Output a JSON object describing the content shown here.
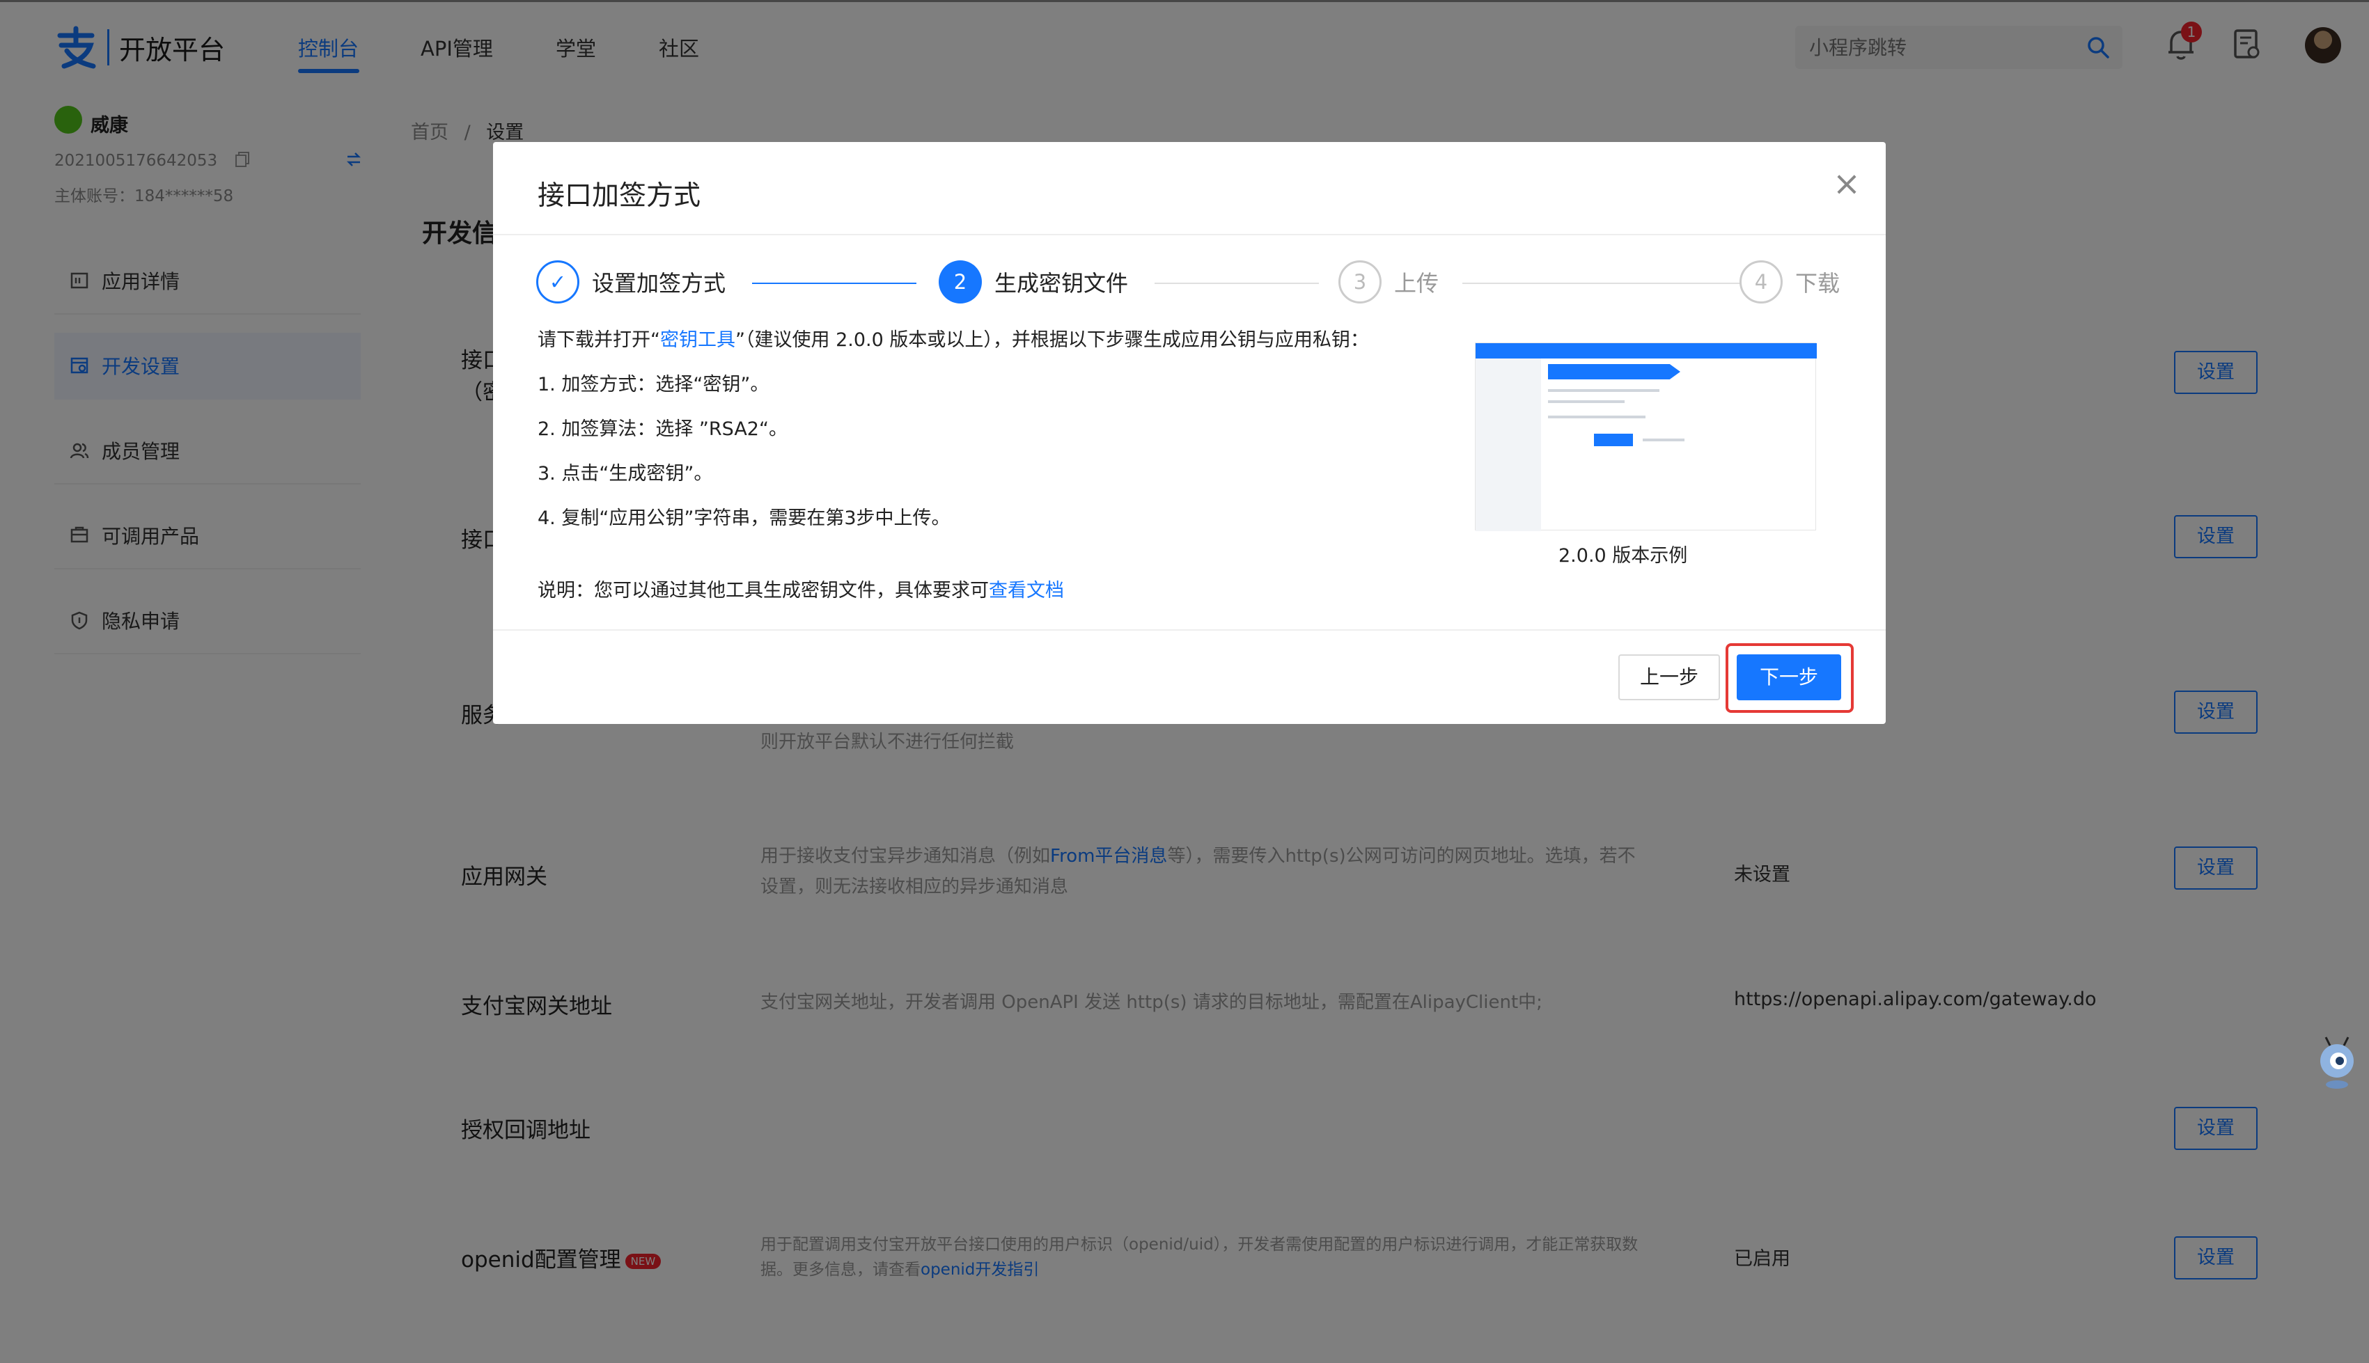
{
  "header": {
    "logo_text": "开放平台",
    "nav": [
      "控制台",
      "API管理",
      "学堂",
      "社区"
    ],
    "search_placeholder": "小程序跳转",
    "notification_count": "1"
  },
  "sidebar": {
    "account_name": "威康",
    "account_id": "2021005176642053",
    "main_account": "主体账号：184******58",
    "items": [
      {
        "label": "应用详情",
        "icon": "app-detail-icon"
      },
      {
        "label": "开发设置",
        "icon": "dev-settings-icon"
      },
      {
        "label": "成员管理",
        "icon": "members-icon"
      },
      {
        "label": "可调用产品",
        "icon": "products-icon"
      },
      {
        "label": "隐私申请",
        "icon": "privacy-icon"
      }
    ]
  },
  "breadcrumb": [
    "首页",
    "/",
    "设置"
  ],
  "main": {
    "card_title": "开发信",
    "rows": [
      {
        "label": "接口",
        "label2": "（密",
        "desc": "",
        "value": "",
        "button": "设置"
      },
      {
        "label": "接口",
        "label2": "",
        "desc": "",
        "value": "",
        "button": "设置"
      },
      {
        "label": "服务",
        "label2": "",
        "desc": "则开放平台默认不进行任何拦截",
        "value": "",
        "button": "设置"
      },
      {
        "label": "应用网关",
        "desc_pre": "用于接收支付宝异步通知消息（例如",
        "desc_link": "From平台消息",
        "desc_post": "等），需要传入http(s)公网可访问的网页地址。选填，若不设置，则无法接收相应的异步通知消息",
        "value": "未设置",
        "button": "设置"
      },
      {
        "label": "支付宝网关地址",
        "desc": "支付宝网关地址，开发者调用 OpenAPI 发送 http(s) 请求的目标地址，需配置在AlipayClient中;",
        "value": "https://openapi.alipay.com/gateway.do",
        "button": ""
      },
      {
        "label": "授权回调地址",
        "desc": "",
        "value": "",
        "button": "设置"
      },
      {
        "label": "openid配置管理",
        "badge": "NEW",
        "desc_pre": "用于配置调用支付宝开放平台接口使用的用户标识（openid/uid），开发者需使用配置的用户标识进行调用，才能正常获取数据。更多信息，请查看",
        "desc_link": "openid开发指引",
        "desc_post": "",
        "value": "已启用",
        "button": "设置"
      }
    ]
  },
  "modal": {
    "title": "接口加签方式",
    "steps": [
      {
        "num": "✓",
        "label": "设置加签方式",
        "state": "done"
      },
      {
        "num": "2",
        "label": "生成密钥文件",
        "state": "active"
      },
      {
        "num": "3",
        "label": "上传",
        "state": "wait"
      },
      {
        "num": "4",
        "label": "下载",
        "state": "wait"
      }
    ],
    "intro_pre": "请下载并打开“",
    "intro_link": "密钥工具",
    "intro_post": "”（建议使用 2.0.0 版本或以上），并根据以下步骤生成应用公钥与应用私钥：",
    "step_lines": [
      "1. 加签方式：选择“密钥”。",
      "2. 加签算法：选择 ”RSA2“。",
      "3. 点击“生成密钥”。",
      "4. 复制“应用公钥”字符串，需要在第3步中上传。"
    ],
    "note_pre": "说明：您可以通过其他工具生成密钥文件，具体要求可",
    "note_link": "查看文档",
    "preview_caption": "2.0.0 版本示例",
    "btn_prev": "上一步",
    "btn_next": "下一步"
  }
}
